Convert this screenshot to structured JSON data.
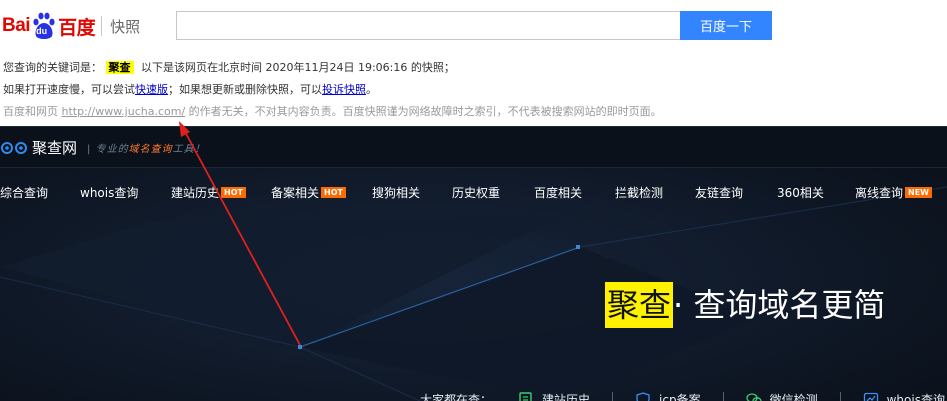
{
  "baidu": {
    "logo": {
      "left_text": "Bai",
      "paw_text": "du",
      "right_text": "百度",
      "sub_label": "快照"
    },
    "search": {
      "value": "",
      "placeholder": ""
    },
    "search_button": "百度一下",
    "line1": {
      "prefix": "您查询的关键词是：",
      "keyword": "聚查",
      "suffix": "以下是该网页在北京时间 2020年11月24日 19:06:16 的快照；"
    },
    "line2": {
      "text1": "如果打开速度慢，可以尝试",
      "link1": "快速版",
      "text2": "；如果想更新或删除快照，可以",
      "link2": "投诉快照",
      "text3": "。"
    },
    "line3": {
      "text1": "百度和网页 ",
      "url": "http://www.jucha.com/",
      "text2": " 的作者无关，不对其内容负责。百度快照谨为网络故障时之索引，不代表被搜索网站的即时页面。"
    }
  },
  "jucha": {
    "logo_text": "聚查网",
    "slogan_pre": "| 专业的",
    "slogan_accent": "域名查询",
    "slogan_post": "工具！",
    "nav": [
      {
        "label": "综合查询",
        "badge": ""
      },
      {
        "label": "whois查询",
        "badge": ""
      },
      {
        "label": "建站历史",
        "badge": "HOT"
      },
      {
        "label": "备案相关",
        "badge": "HOT"
      },
      {
        "label": "搜狗相关",
        "badge": ""
      },
      {
        "label": "历史权重",
        "badge": ""
      },
      {
        "label": "百度相关",
        "badge": ""
      },
      {
        "label": "拦截检测",
        "badge": ""
      },
      {
        "label": "友链查询",
        "badge": ""
      },
      {
        "label": "360相关",
        "badge": ""
      },
      {
        "label": "离线查询",
        "badge": "NEW"
      }
    ],
    "hero": {
      "highlight": "聚查",
      "rest": " · 查询域名更简"
    },
    "searching_label": "大家都在查：",
    "searching_items": [
      {
        "label": "建站历史",
        "icon": "history-icon"
      },
      {
        "label": "icp备案",
        "icon": "icp-icon"
      },
      {
        "label": "微信检测",
        "icon": "wechat-icon"
      },
      {
        "label": "whois查询",
        "icon": "whois-icon"
      }
    ]
  },
  "colors": {
    "baidu_red": "#e10601",
    "baidu_blue": "#3385ff",
    "dark_bg": "#0d1420",
    "hot_badge": "#ff6a00",
    "highlight_yellow": "#fff200",
    "arrow_red": "#e0201c"
  }
}
